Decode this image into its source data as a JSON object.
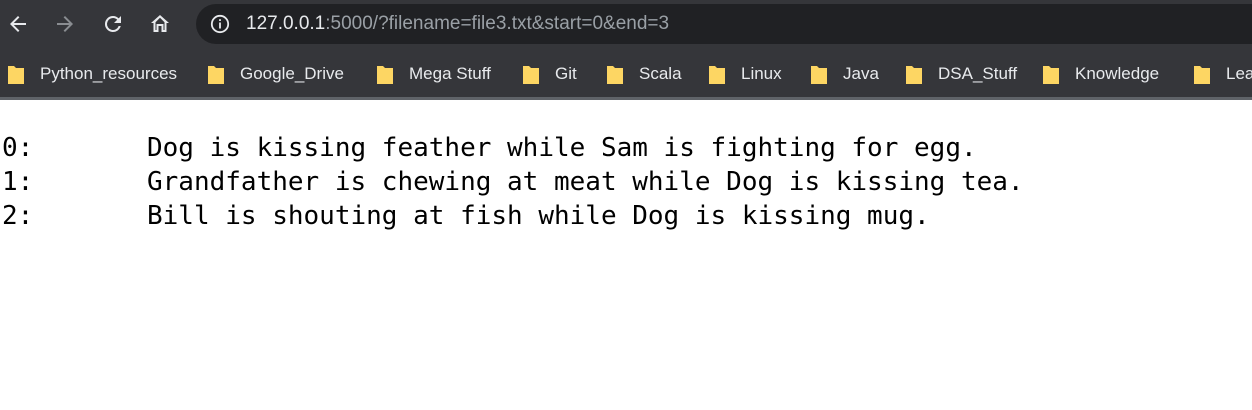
{
  "browser": {
    "url_host": "127.0.0.1",
    "url_rest": ":5000/?filename=file3.txt&start=0&end=3",
    "bookmarks": [
      {
        "label": "Python_resources"
      },
      {
        "label": "Google_Drive"
      },
      {
        "label": "Mega Stuff"
      },
      {
        "label": "Git"
      },
      {
        "label": "Scala"
      },
      {
        "label": "Linux"
      },
      {
        "label": "Java"
      },
      {
        "label": "DSA_Stuff"
      },
      {
        "label": "Knowledge"
      },
      {
        "label": "Lea"
      }
    ],
    "colors": {
      "chrome_bg": "#35363a",
      "omnibox_bg": "#202124",
      "folder_yellow": "#fdd663"
    }
  },
  "content": {
    "lines": [
      {
        "index": "0:",
        "text": "Dog is kissing feather while Sam is fighting for egg."
      },
      {
        "index": "1:",
        "text": "Grandfather is chewing at meat while Dog is kissing tea."
      },
      {
        "index": "2:",
        "text": "Bill is shouting at fish while Dog is kissing mug."
      }
    ]
  }
}
